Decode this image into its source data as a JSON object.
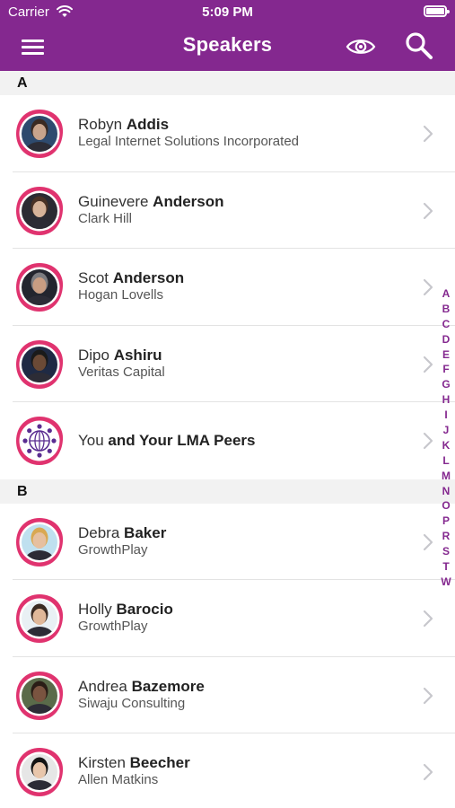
{
  "status_bar": {
    "carrier": "Carrier",
    "time": "5:09 PM"
  },
  "header": {
    "title": "Speakers",
    "menu_icon": "hamburger-menu-icon",
    "view_icon": "eye-icon",
    "search_icon": "search-icon"
  },
  "colors": {
    "brand": "#84288f",
    "avatar_ring": "#e0336f",
    "section_bg": "#f2f2f2",
    "chevron": "#c7c7cc"
  },
  "sections": [
    {
      "letter": "A",
      "speakers": [
        {
          "first": "Robyn",
          "last": "Addis",
          "org": "Legal Internet Solutions Incorporated"
        },
        {
          "first": "Guinevere",
          "last": "Anderson",
          "org": "Clark Hill"
        },
        {
          "first": "Scot",
          "last": "Anderson",
          "org": "Hogan Lovells"
        },
        {
          "first": "Dipo",
          "last": "Ashiru",
          "org": "Veritas Capital"
        },
        {
          "first": "You",
          "last": "and Your LMA Peers",
          "org": "",
          "icon": "network-globe-icon"
        }
      ]
    },
    {
      "letter": "B",
      "speakers": [
        {
          "first": "Debra",
          "last": "Baker",
          "org": "GrowthPlay"
        },
        {
          "first": "Holly",
          "last": "Barocio",
          "org": "GrowthPlay"
        },
        {
          "first": "Andrea",
          "last": "Bazemore",
          "org": "Siwaju Consulting"
        },
        {
          "first": "Kirsten",
          "last": "Beecher",
          "org": "Allen Matkins"
        }
      ]
    }
  ],
  "index_letters": [
    "A",
    "B",
    "C",
    "D",
    "E",
    "F",
    "G",
    "H",
    "I",
    "J",
    "K",
    "L",
    "M",
    "N",
    "O",
    "P",
    "R",
    "S",
    "T",
    "W"
  ]
}
